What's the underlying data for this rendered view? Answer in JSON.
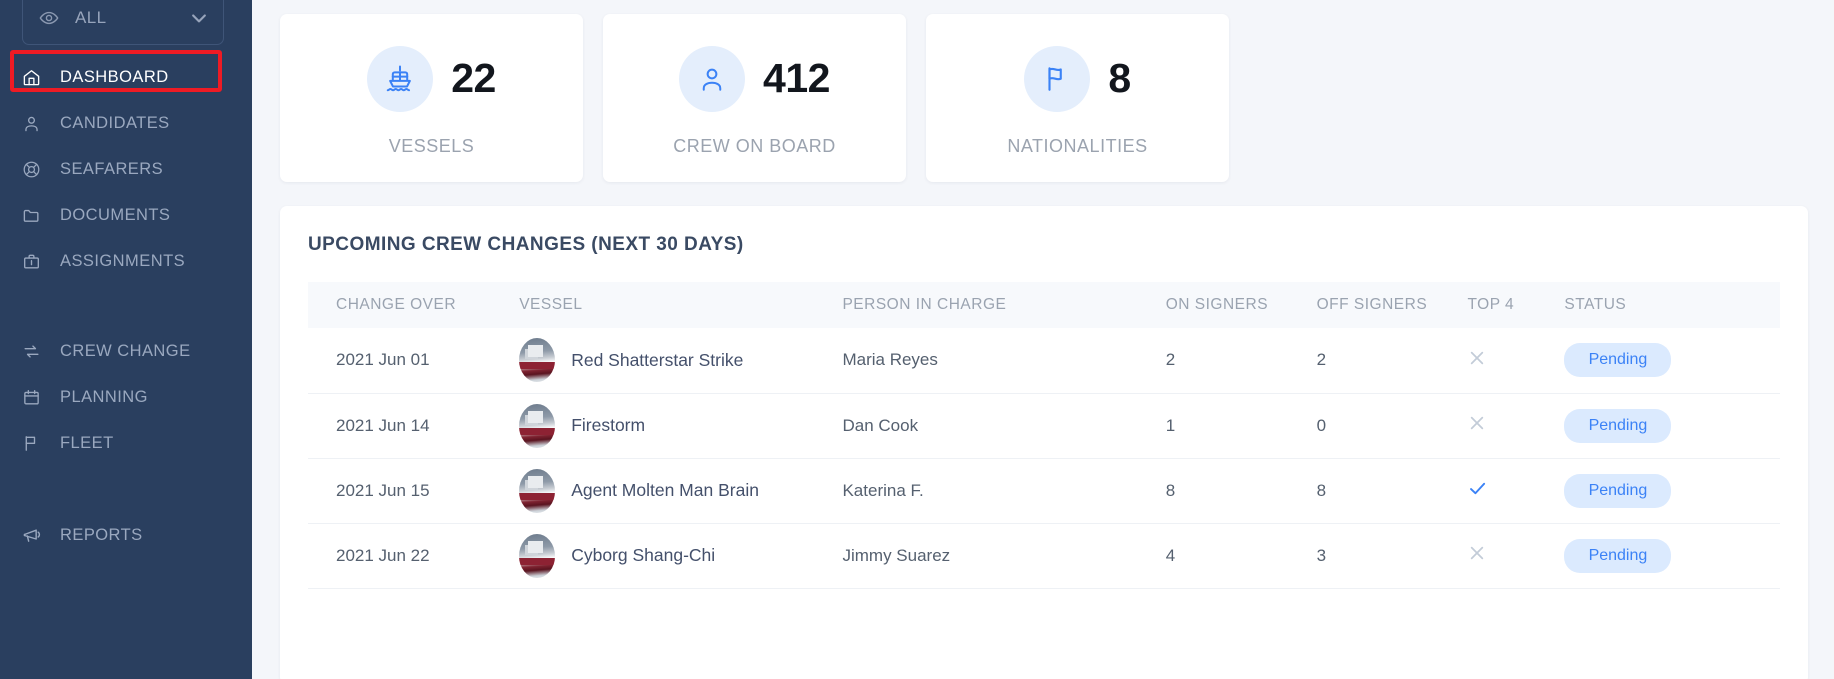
{
  "sidebar": {
    "filter": {
      "label": "ALL",
      "icon": "eye-icon",
      "chevron": "chevron-down-icon"
    },
    "items": [
      {
        "label": "DASHBOARD",
        "icon": "home-icon",
        "active": true
      },
      {
        "label": "CANDIDATES",
        "icon": "person-icon",
        "active": false
      },
      {
        "label": "SEAFARERS",
        "icon": "lifebuoy-icon",
        "active": false
      },
      {
        "label": "DOCUMENTS",
        "icon": "folder-icon",
        "active": false
      },
      {
        "label": "ASSIGNMENTS",
        "icon": "briefcase-icon",
        "active": false
      },
      {
        "label": "CREW CHANGE",
        "icon": "exchange-icon",
        "active": false
      },
      {
        "label": "PLANNING",
        "icon": "calendar-icon",
        "active": false
      },
      {
        "label": "FLEET",
        "icon": "flag-icon",
        "active": false
      },
      {
        "label": "REPORTS",
        "icon": "megaphone-icon",
        "active": false
      }
    ],
    "background_color": "#2a3f5f",
    "highlight_color": "#ee1b24"
  },
  "stats": [
    {
      "value": "22",
      "label": "VESSELS",
      "icon": "ship-icon"
    },
    {
      "value": "412",
      "label": "CREW ON BOARD",
      "icon": "person-icon"
    },
    {
      "value": "8",
      "label": "NATIONALITIES",
      "icon": "flag-icon"
    }
  ],
  "panel": {
    "title": "UPCOMING CREW CHANGES (NEXT 30 DAYS)",
    "columns": [
      "CHANGE OVER",
      "VESSEL",
      "PERSON IN CHARGE",
      "ON SIGNERS",
      "OFF SIGNERS",
      "TOP 4",
      "STATUS"
    ],
    "rows": [
      {
        "change_over": "2021 Jun 01",
        "vessel": "Red Shatterstar Strike",
        "person": "Maria Reyes",
        "on": "2",
        "off": "2",
        "top4": false,
        "status": "Pending"
      },
      {
        "change_over": "2021 Jun 14",
        "vessel": "Firestorm",
        "person": "Dan Cook",
        "on": "1",
        "off": "0",
        "top4": false,
        "status": "Pending"
      },
      {
        "change_over": "2021 Jun 15",
        "vessel": "Agent Molten Man Brain",
        "person": "Katerina F.",
        "on": "8",
        "off": "8",
        "top4": true,
        "status": "Pending"
      },
      {
        "change_over": "2021 Jun 22",
        "vessel": "Cyborg Shang-Chi",
        "person": "Jimmy Suarez",
        "on": "4",
        "off": "3",
        "top4": false,
        "status": "Pending"
      }
    ],
    "badge_bg": "#dbeafe",
    "badge_color": "#3b82f6",
    "check_color": "#3b82f6",
    "cross_color": "#c3ccd8"
  }
}
